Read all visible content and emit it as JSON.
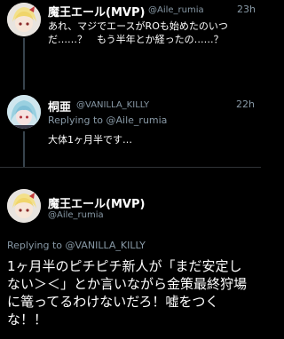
{
  "tweets": [
    {
      "name": "魔王エール(MVP)",
      "handle": "@Aile_rumia",
      "time": "23h",
      "text": "あれ、マジでエースがROも始めたのいつだ……？　もう半年とか経ったの……？"
    },
    {
      "name": "桐亜",
      "handle": "@VANILLA_KILLY",
      "time": "22h",
      "reply_prefix": "Replying to",
      "reply_to": "@Aile_rumia",
      "text": "大体1ヶ月半です…"
    },
    {
      "name": "魔王エール(MVP)",
      "handle": "@Aile_rumia",
      "reply_prefix": "Replying to",
      "reply_to": "@VANILLA_KILLY",
      "text": "1ヶ月半のピチピチ新人が「まだ安定しない＞＜」とか言いながら金策最終狩場に篭ってるわけないだろ！嘘をつくな！！"
    }
  ],
  "colors": {
    "background": "#000000",
    "text": "#ffffff",
    "muted": "#8899a6",
    "divider": "#2f3336"
  }
}
